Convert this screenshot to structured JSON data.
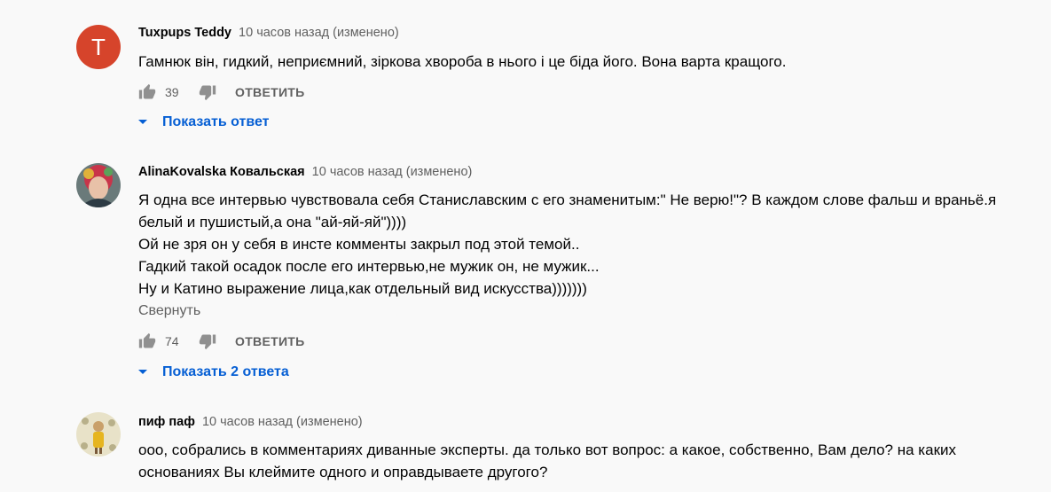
{
  "comments": [
    {
      "author": "Tuxpups Teddy",
      "avatar_letter": "T",
      "time": "10 часов назад (изменено)",
      "lines": [
        "Гамнюк він, гидкий, неприємний, зіркова хвороба в нього і це біда його. Вона варта кращого."
      ],
      "likes": "39",
      "reply_label": "ОТВЕТИТЬ",
      "replies_label": "Показать ответ"
    },
    {
      "author": "AlinaKovalska Ковальская",
      "time": "10 часов назад (изменено)",
      "lines": [
        "Я одна все интервью чувствовала себя Станиславским с его знаменитым:\" Не верю!\"? В каждом слове фальш и враньё.я",
        "белый и пушистый,а она \"ай-яй-яй\"))))",
        "Ой не зря он у себя в инсте комменты закрыл под этой темой..",
        "Гадкий такой осадок после его интервью,не мужик он, не мужик...",
        "Ну и Катино выражение лица,как отдельный вид искусства)))))))"
      ],
      "collapse_label": "Свернуть",
      "likes": "74",
      "reply_label": "ОТВЕТИТЬ",
      "replies_label": "Показать 2 ответа"
    },
    {
      "author": "пиф паф",
      "time": "10 часов назад (изменено)",
      "lines": [
        "ооо, собрались в комментариях диванные эксперты. да только вот вопрос: а какое, собственно, Вам дело? на каких",
        "основаниях Вы клеймите одного и оправдываете другого?"
      ]
    }
  ],
  "colors": {
    "link": "#065fd4",
    "secondary_text": "#606060",
    "avatar_letter_bg": "#d6442b",
    "background": "#f9f9f9"
  }
}
